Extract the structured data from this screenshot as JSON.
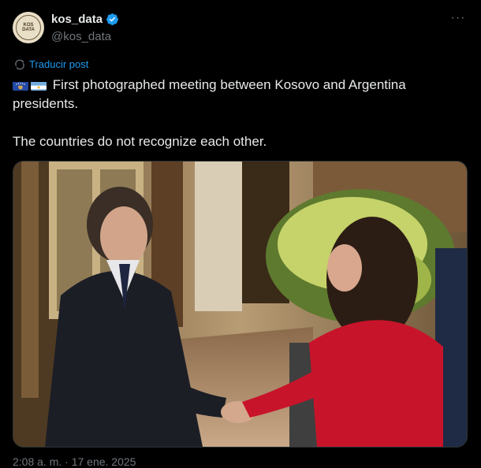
{
  "author": {
    "display_name": "kos_data",
    "handle": "@kos_data",
    "avatar_text": "KOS DATA",
    "verified": true
  },
  "menu_icon": "more-horizontal-icon",
  "translate": {
    "label": "Traducir post",
    "icon": "translate-icon"
  },
  "post": {
    "flags": [
      "kosovo-flag",
      "argentina-flag"
    ],
    "line1": "First photographed meeting between Kosovo and Argentina presidents.",
    "line2": "The countries do not recognize each other."
  },
  "media": {
    "kind": "photo"
  },
  "timestamp": "2:08 a. m. · 17 ene. 2025",
  "colors": {
    "background": "#000000",
    "text": "#e7e9ea",
    "secondary": "#71767b",
    "link": "#1d9bf0",
    "verified": "#1d9bf0"
  }
}
